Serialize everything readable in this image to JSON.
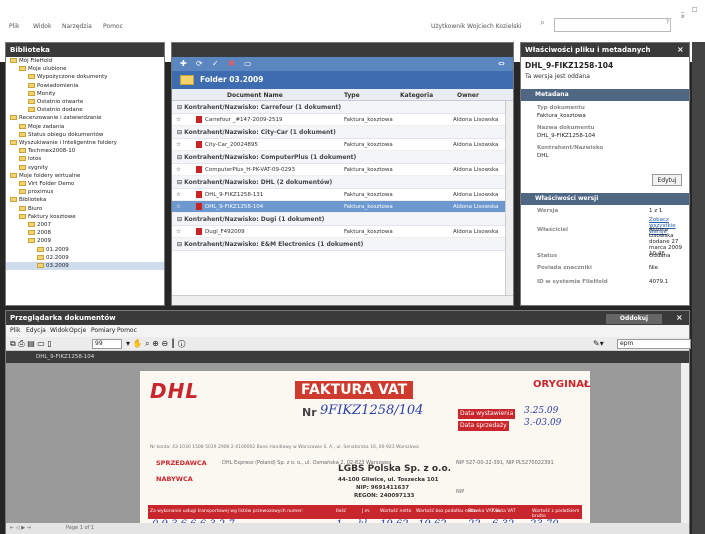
{
  "menubar": {
    "items": [
      "Plik",
      "Widok",
      "Narzędzia",
      "Pomoc"
    ],
    "user_label": "Użytkownik Wojciech Kozielski",
    "search_placeholder": "",
    "search_button": "?",
    "window_controls": "_ □ x"
  },
  "library": {
    "title": "Biblioteka",
    "tree": [
      "Mój FileHold",
      "Moje ulubione",
      "Wypożyczone dokumenty",
      "Powiadomienia",
      "Monity",
      "Ostatnio otwarte",
      "Ostatnio dodane",
      "Recenzowanie i zatwierdzanie",
      "Moje zadania",
      "Status obiegu dokumentów",
      "Wyszukiwanie i Inteligentne foldery",
      "Techmex2008-10",
      "lotos",
      "sygnity",
      "Moje foldery wirtualne",
      "Virt Folder Demo",
      "proximus",
      "Biblioteka",
      "Biuro",
      "Faktury kosztowe",
      "2007",
      "2008",
      "2009",
      "01.2009",
      "02.2009",
      "03.2009"
    ]
  },
  "folder": {
    "title": "Folder 03.2009",
    "columns": [
      "Document Name",
      "Type",
      "Kategoria",
      "Owner"
    ],
    "groups": [
      {
        "label": "Kontrahent/Nazwisko: Carrefour (1 dokument)",
        "rows": [
          {
            "name": "Carrefour _#147-2009-2519",
            "type": "Faktura_kosztowa",
            "owner": "Aldona Lisowska"
          }
        ]
      },
      {
        "label": "Kontrahent/Nazwisko: City-Car (1 dokument)",
        "rows": [
          {
            "name": "City-Car_20024895",
            "type": "Faktura_kosztowa",
            "owner": "Aldona Lisowska"
          }
        ]
      },
      {
        "label": "Kontrahent/Nazwisko: ComputerPlus (1 dokument)",
        "rows": [
          {
            "name": "ComputerPlus_H-PK-VAT-09-0293",
            "type": "Faktura_kosztowa",
            "owner": "Aldona Lisowska"
          }
        ]
      },
      {
        "label": "Kontrahent/Nazwisko: DHL (2 dokumentów)",
        "rows": [
          {
            "name": "DHL_9-FIKZ1258-131",
            "type": "Faktura_kosztowa",
            "owner": "Aldona Lisowska"
          },
          {
            "name": "DHL_9-FIKZ1258-104",
            "type": "Faktura_kosztowa",
            "owner": "Aldona Lisowska"
          }
        ]
      },
      {
        "label": "Kontrahent/Nazwisko: Dugi (1 dokument)",
        "rows": [
          {
            "name": "Dugi_F492009",
            "type": "Faktura_kosztowa",
            "owner": "Aldona Lisowska"
          }
        ]
      },
      {
        "label": "Kontrahent/Nazwisko: E&M Electronics (1 dokument)",
        "rows": []
      }
    ]
  },
  "props": {
    "title": "Właściwości pliku i metadanych",
    "doc_name": "DHL_9-FIKZ1258-104",
    "doc_status": "Ta wersja jest oddana",
    "section_meta": "Metadana",
    "meta": [
      {
        "label": "Typ dokumentu",
        "value": "Faktura_kosztowa"
      },
      {
        "label": "Nazwa dokumentu",
        "value": "DHL_9-FIKZ1258-104"
      },
      {
        "label": "Kontrahent/Nazwisko",
        "value": "DHL"
      }
    ],
    "edit_button": "Edytuj",
    "section_version": "Właściwości wersji",
    "version": [
      {
        "label": "Wersja",
        "value": "1 z 1"
      },
      {
        "label": "",
        "value": "Zobacz wszystkie wersje"
      },
      {
        "label": "Właściciel",
        "value": "Aldona Lisowska dodane 27 marca 2009 10:46"
      },
      {
        "label": "Status",
        "value": "Oddana"
      },
      {
        "label": "Posiada znaczniki",
        "value": "Nie"
      },
      {
        "label": "ID w systemie FileHold",
        "value": "4079.1"
      }
    ]
  },
  "viewer": {
    "title": "Przeglądarka dokumentów",
    "undock_button": "Oddokuj",
    "menu": [
      "Plik",
      "Edycja",
      "Widok",
      "Opcje",
      "Pomiary",
      "Pomoc"
    ],
    "page_input": "99",
    "zoom_select": "epm",
    "tab_label": "DHL_9-FIKZ1258-104",
    "status": "Page 1 of 1"
  },
  "invoice": {
    "title": "FAKTURA VAT",
    "original": "ORYGINAŁ",
    "number_label": "Nr",
    "number_value": "9FIKZ1258/104",
    "issue_label": "Data wystawienia",
    "issue_value": "3.25.09",
    "sale_label": "Data sprzedaży",
    "sale_value": "3.-03.09",
    "bank_line": "Nr konta: 43 1030 1508 5019 2906 2 4100002 Bank Handlowy w Warszawie S. A., ul. Senatorska 16, 00-923 Warszawa",
    "seller_label": "SPRZEDAWCA",
    "seller_value": "DHL Express (Poland) Sp. z o. o., ul. Osmańska 2, 02-823 Warszawa",
    "seller_nip": "NIP 527-00-22-391, NIP PL5270022391",
    "buyer_label": "NABYWCA",
    "buyer_nip": "NIP",
    "stamp_company": "LGBS Polska Sp. z o.o.",
    "stamp_address": "44-100 Gliwice, ul. Toszecka 101",
    "stamp_nip": "NIP: 9691411637",
    "stamp_regon": "REGON: 240097133",
    "table_headers": [
      "Za wykonanie usługi transportowej wg listów przewozowych numer:",
      "Ilość",
      "J.m.",
      "Wartość netto",
      "Wartość bez podatku netto",
      "Stawka VAT %",
      "Kwota VAT",
      "Wartość z podatkiem brutto"
    ],
    "table_values": [
      "0 9 3 6 6 6 3 2 7",
      "1",
      "kl",
      "19 62",
      "19 62",
      "22",
      "6 32",
      "23 70"
    ]
  }
}
